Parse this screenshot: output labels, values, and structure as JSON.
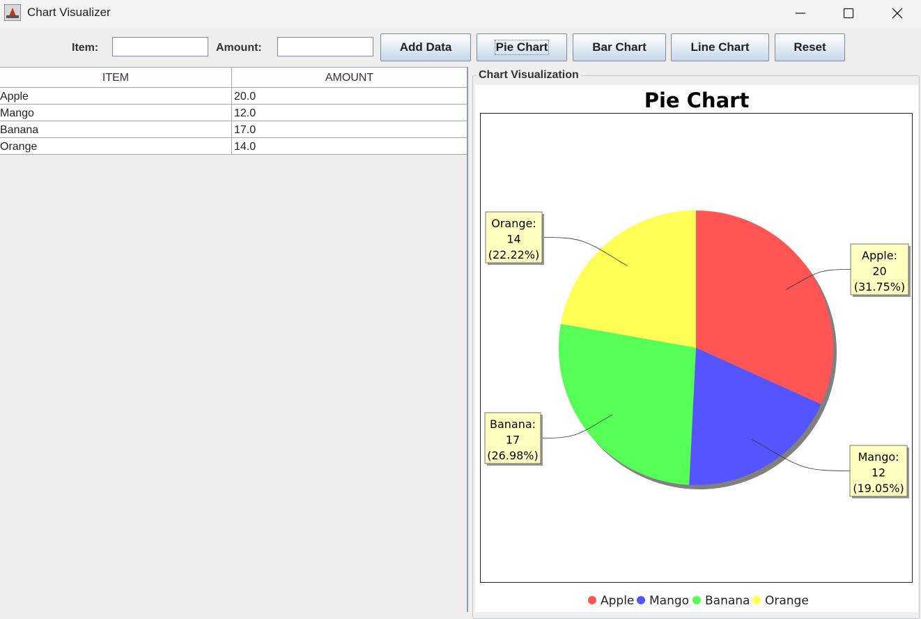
{
  "window": {
    "title": "Chart Visualizer"
  },
  "toolbar": {
    "item_label": "Item:",
    "item_value": "",
    "amount_label": "Amount:",
    "amount_value": "",
    "add_data": "Add Data",
    "pie_chart": "Pie Chart",
    "bar_chart": "Bar Chart",
    "line_chart": "Line Chart",
    "reset": "Reset"
  },
  "table": {
    "headers": [
      "ITEM",
      "AMOUNT"
    ],
    "rows": [
      {
        "item": "Apple",
        "amount": "20.0"
      },
      {
        "item": "Mango",
        "amount": "12.0"
      },
      {
        "item": "Banana",
        "amount": "17.0"
      },
      {
        "item": "Orange",
        "amount": "14.0"
      }
    ]
  },
  "panel": {
    "title": "Chart Visualization"
  },
  "chart_data": {
    "type": "pie",
    "title": "Pie Chart",
    "categories": [
      "Apple",
      "Mango",
      "Banana",
      "Orange"
    ],
    "values": [
      20,
      12,
      17,
      14
    ],
    "labels": [
      {
        "name": "Apple:",
        "value": "20",
        "percent": "(31.75%)"
      },
      {
        "name": "Mango:",
        "value": "12",
        "percent": "(19.05%)"
      },
      {
        "name": "Banana:",
        "value": "17",
        "percent": "(26.98%)"
      },
      {
        "name": "Orange:",
        "value": "14",
        "percent": "(22.22%)"
      }
    ],
    "colors": [
      "#ff5555",
      "#5555ff",
      "#55ff55",
      "#ffff55"
    ],
    "legend": [
      "Apple",
      "Mango",
      "Banana",
      "Orange"
    ],
    "legend_position": "bottom"
  }
}
